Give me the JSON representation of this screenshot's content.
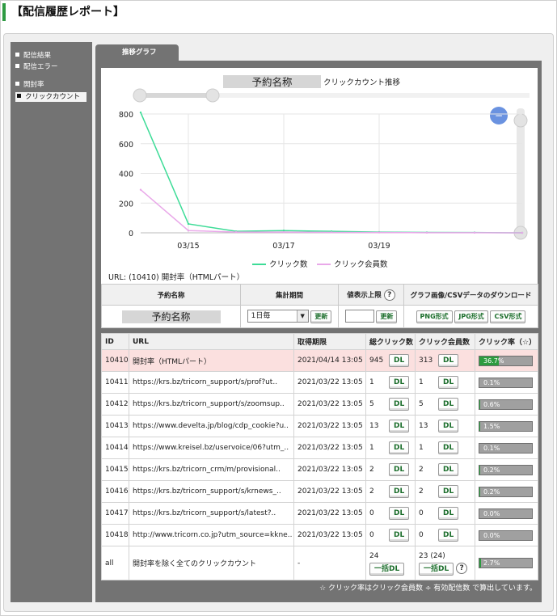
{
  "header": {
    "title": "【配信履歴レポート】"
  },
  "sidebar": {
    "items": [
      {
        "label": "配信結果",
        "top": 63,
        "active": false
      },
      {
        "label": "配信エラー",
        "top": 77,
        "active": false
      },
      {
        "label": "開封率",
        "top": 99,
        "active": false
      },
      {
        "label": "クリックカウント",
        "top": 114,
        "active": true
      }
    ]
  },
  "tab": {
    "label": "推移グラフ"
  },
  "chart": {
    "title_box": "予約名称",
    "title_suffix": "クリックカウント推移",
    "url_note": "URL: (10410) 開封率（HTMLパート）",
    "zoom_button": "−"
  },
  "chart_data": {
    "type": "line",
    "title": "予約名称 クリックカウント推移",
    "x": [
      "03/14",
      "03/15",
      "03/16",
      "03/17",
      "03/18",
      "03/19",
      "03/20",
      "03/21",
      "03/22"
    ],
    "xticks": [
      "03/15",
      "03/17",
      "03/19"
    ],
    "ylim": [
      0,
      800
    ],
    "yticks": [
      0,
      200,
      400,
      600,
      800
    ],
    "grid": true,
    "legend_position": "bottom-center",
    "series": [
      {
        "name": "クリック数",
        "color": "#3ddc97",
        "values": [
          810,
          60,
          10,
          15,
          10,
          5,
          3,
          2,
          0
        ]
      },
      {
        "name": "クリック会員数",
        "color": "#e9a8e9",
        "values": [
          290,
          15,
          5,
          5,
          3,
          2,
          1,
          1,
          0
        ]
      }
    ]
  },
  "controls": {
    "headers": [
      "予約名称",
      "集計期間",
      "値表示上限",
      "グラフ画像/CSVデータのダウンロード"
    ],
    "name_value": "予約名称",
    "period_value": "1日毎",
    "update_label": "更新",
    "help_label": "?",
    "download_buttons": [
      "PNG形式",
      "JPG形式",
      "CSV形式"
    ]
  },
  "table": {
    "headers": [
      "ID",
      "URL",
      "取得期限",
      "総クリック数",
      "クリック会員数",
      "クリック率（☆）"
    ],
    "dl_label": "DL",
    "rows": [
      {
        "id": "10410",
        "url": "開封率（HTMLパート）",
        "date": "2021/04/14 13:05",
        "clicks": "945",
        "members": "313",
        "rate": "36.7%",
        "rate_value": 36.7,
        "highlight": true
      },
      {
        "id": "10411",
        "url": "https://krs.bz/tricorn_support/s/prof?ut..",
        "date": "2021/03/22 13:05",
        "clicks": "1",
        "members": "1",
        "rate": "0.1%",
        "rate_value": 0.1,
        "highlight": false
      },
      {
        "id": "10412",
        "url": "https://krs.bz/tricorn_support/s/zoomsup..",
        "date": "2021/03/22 13:05",
        "clicks": "5",
        "members": "5",
        "rate": "0.6%",
        "rate_value": 0.6,
        "highlight": false
      },
      {
        "id": "10413",
        "url": "https://www.develta.jp/blog/cdp_cookie?u..",
        "date": "2021/03/22 13:05",
        "clicks": "13",
        "members": "13",
        "rate": "1.5%",
        "rate_value": 1.5,
        "highlight": false
      },
      {
        "id": "10414",
        "url": "https://www.kreisel.bz/uservoice/06?utm_..",
        "date": "2021/03/22 13:05",
        "clicks": "1",
        "members": "1",
        "rate": "0.1%",
        "rate_value": 0.1,
        "highlight": false
      },
      {
        "id": "10415",
        "url": "https://krs.bz/tricorn_crm/m/provisional..",
        "date": "2021/03/22 13:05",
        "clicks": "2",
        "members": "2",
        "rate": "0.2%",
        "rate_value": 0.2,
        "highlight": false
      },
      {
        "id": "10416",
        "url": "https://krs.bz/tricorn_support/s/krnews_..",
        "date": "2021/03/22 13:05",
        "clicks": "2",
        "members": "2",
        "rate": "0.2%",
        "rate_value": 0.2,
        "highlight": false
      },
      {
        "id": "10417",
        "url": "https://krs.bz/tricorn_support/s/latest?..",
        "date": "2021/03/22 13:05",
        "clicks": "0",
        "members": "0",
        "rate": "0.0%",
        "rate_value": 0.0,
        "highlight": false
      },
      {
        "id": "10418",
        "url": "http://www.tricorn.co.jp?utm_source=kkne..",
        "date": "2021/03/22 13:05",
        "clicks": "0",
        "members": "0",
        "rate": "0.0%",
        "rate_value": 0.0,
        "highlight": false
      }
    ],
    "total": {
      "id": "all",
      "url": "開封率を除く全てのクリックカウント",
      "date": "-",
      "clicks": "24",
      "members": "23 (24)",
      "rate": "2.7%",
      "rate_value": 2.7,
      "bulk_label": "一括DL",
      "help_label": "?"
    }
  },
  "footer": {
    "note": "☆ クリック率はクリック会員数 ÷ 有効配信数 で算出しています。"
  }
}
